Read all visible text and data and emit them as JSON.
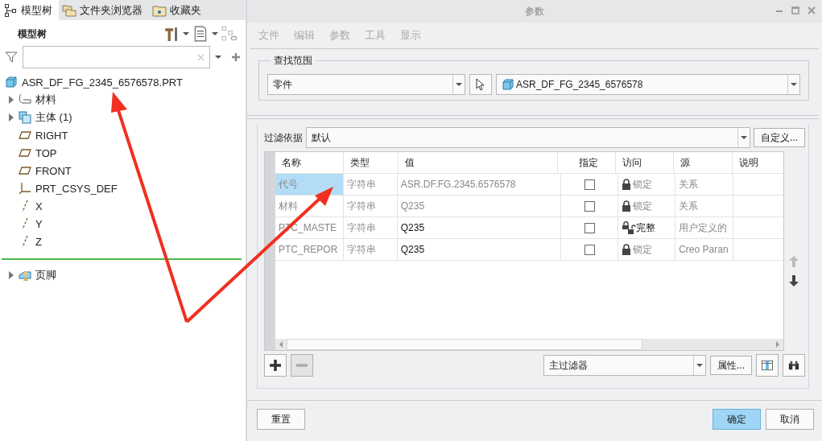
{
  "left_tabs": [
    {
      "label": "模型树",
      "selected": true
    },
    {
      "label": "文件夹浏览器",
      "selected": false
    },
    {
      "label": "收藏夹",
      "selected": false
    }
  ],
  "tree_header": {
    "title": "模型树"
  },
  "tree": [
    {
      "label": "ASR_DF_FG_2345_6576578.PRT",
      "kind": "part",
      "children": [
        {
          "label": "材料",
          "kind": "material",
          "expanded": false
        },
        {
          "label": "主体 (1)",
          "kind": "body",
          "expanded": false
        },
        {
          "label": "RIGHT",
          "kind": "plane"
        },
        {
          "label": "TOP",
          "kind": "plane"
        },
        {
          "label": "FRONT",
          "kind": "plane"
        },
        {
          "label": "PRT_CSYS_DEF",
          "kind": "csys"
        },
        {
          "label": "X",
          "kind": "axis"
        },
        {
          "label": "Y",
          "kind": "axis"
        },
        {
          "label": "Z",
          "kind": "axis"
        }
      ]
    }
  ],
  "footer_item": {
    "label": "页脚",
    "kind": "footer",
    "expanded": false
  },
  "dialog": {
    "title": "参数",
    "menu": [
      "文件",
      "编辑",
      "参数",
      "工具",
      "显示"
    ],
    "scope": {
      "title": "查找范围",
      "type": "零件",
      "object": "ASR_DF_FG_2345_6576578"
    },
    "filter": {
      "label": "过滤依据",
      "value": "默认",
      "button": "自定义..."
    },
    "table": {
      "columns": [
        "名称",
        "类型",
        "值",
        "指定",
        "访问",
        "源",
        "说明"
      ],
      "rows": [
        {
          "name": "代号",
          "type": "字符串",
          "value": "ASR.DF.FG.2345.6576578",
          "designated": false,
          "access": "锁定",
          "locked": true,
          "source": "关系",
          "editable": false,
          "selected": true
        },
        {
          "name": "材料",
          "type": "字符串",
          "value": "Q235",
          "designated": false,
          "access": "锁定",
          "locked": true,
          "source": "关系",
          "editable": false,
          "selected": false
        },
        {
          "name": "PTC_MASTE",
          "type": "字符串",
          "value": "Q235",
          "designated": false,
          "access": "完整",
          "locked": false,
          "source": "用户定义的",
          "editable": true,
          "selected": false
        },
        {
          "name": "PTC_REPOR",
          "type": "字符串",
          "value": "Q235",
          "designated": false,
          "access": "锁定",
          "locked": true,
          "source": "Creo Paran",
          "editable": true,
          "selected": false
        }
      ]
    },
    "main_filter": "主过滤器",
    "properties_button": "属性...",
    "buttons": [
      {
        "label": "重置",
        "default": false
      },
      {
        "label": "确定",
        "default": true
      },
      {
        "label": "取消",
        "default": false
      }
    ]
  }
}
